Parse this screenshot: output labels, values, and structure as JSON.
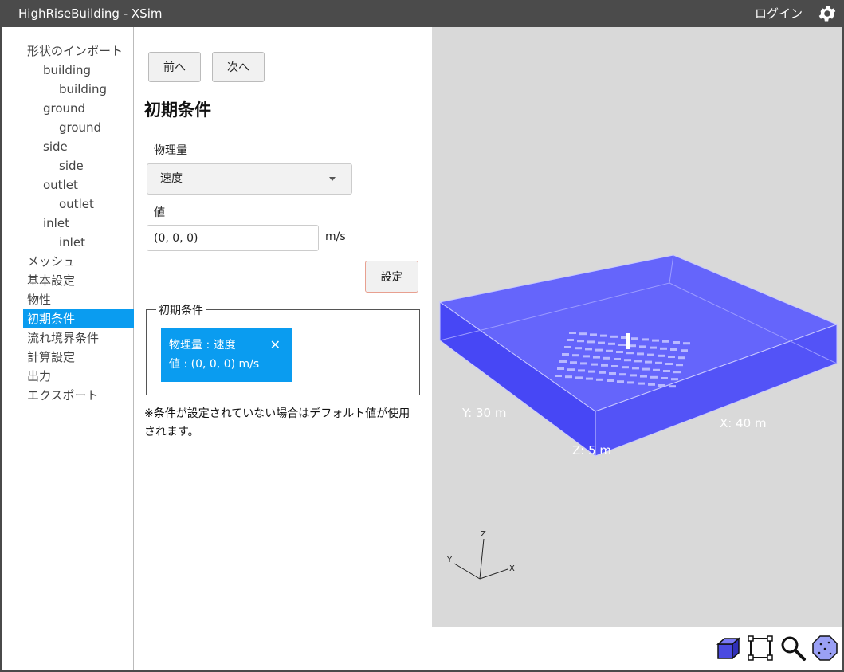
{
  "window": {
    "title": "HighRiseBuilding - XSim",
    "login_label": "ログイン"
  },
  "sidebar": {
    "items": [
      {
        "label": "形状のインポート",
        "level": 0
      },
      {
        "label": "building",
        "level": 1
      },
      {
        "label": "building",
        "level": 2
      },
      {
        "label": "ground",
        "level": 1
      },
      {
        "label": "ground",
        "level": 2
      },
      {
        "label": "side",
        "level": 1
      },
      {
        "label": "side",
        "level": 2
      },
      {
        "label": "outlet",
        "level": 1
      },
      {
        "label": "outlet",
        "level": 2
      },
      {
        "label": "inlet",
        "level": 1
      },
      {
        "label": "inlet",
        "level": 2
      },
      {
        "label": "メッシュ",
        "level": 0
      },
      {
        "label": "基本設定",
        "level": 0
      },
      {
        "label": "物性",
        "level": 0
      },
      {
        "label": "初期条件",
        "level": 0,
        "active": true
      },
      {
        "label": "流れ境界条件",
        "level": 0
      },
      {
        "label": "計算設定",
        "level": 0
      },
      {
        "label": "出力",
        "level": 0
      },
      {
        "label": "エクスポート",
        "level": 0
      }
    ]
  },
  "panel": {
    "prev_label": "前へ",
    "next_label": "次へ",
    "title": "初期条件",
    "quantity_label": "物理量",
    "quantity_selected": "速度",
    "value_label": "値",
    "value_input": "(0, 0, 0)",
    "unit": "m/s",
    "set_label": "設定",
    "fieldset_legend": "初期条件",
    "chip": {
      "line1": "物理量 : 速度",
      "line2": "値 : (0, 0, 0) m/s"
    },
    "note": "※条件が設定されていない場合はデフォルト値が使用されます。"
  },
  "viewport": {
    "dim_x": "X: 40 m",
    "dim_y": "Y: 30 m",
    "dim_z": "Z: 5 m",
    "axis_x": "X",
    "axis_y": "Y",
    "axis_z": "Z",
    "box_color": "#5a5afa",
    "tools": [
      "cube-view-icon",
      "fit-view-icon",
      "zoom-icon",
      "point-cloud-icon"
    ]
  },
  "colors": {
    "accent": "#0a9cf0",
    "titlebar": "#4b4b4b",
    "viewport_bg": "#d9d9d9"
  }
}
